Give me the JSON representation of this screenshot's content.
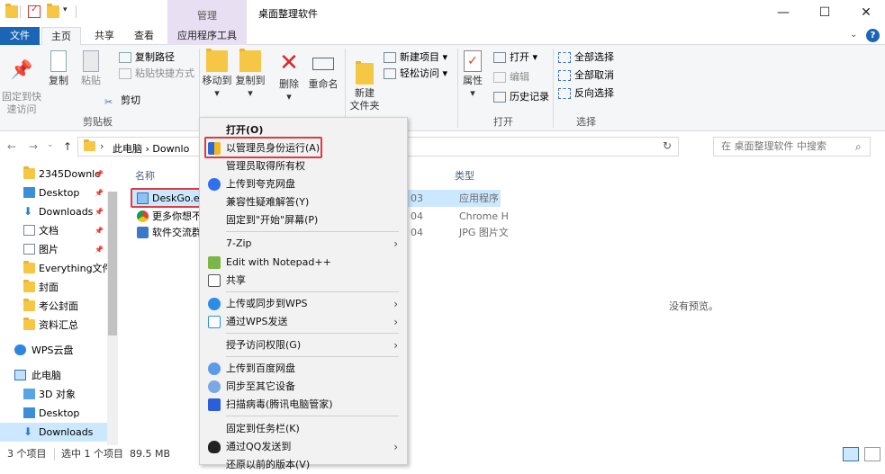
{
  "titlebar": {
    "manage": "管理",
    "title": "桌面整理软件",
    "minimize": "—",
    "maximize": "☐",
    "close": "✕"
  },
  "tabs": {
    "file": "文件",
    "home": "主页",
    "share": "共享",
    "view": "查看",
    "apptools": "应用程序工具"
  },
  "ribbon": {
    "pin": "固定到快\n速访问",
    "copy": "复制",
    "paste": "粘贴",
    "copy_path": "复制路径",
    "paste_shortcut": "粘贴快捷方式",
    "cut": "剪切",
    "clipboard": "剪贴板",
    "move_to": "移动到",
    "copy_to": "复制到",
    "delete": "删除",
    "rename": "重命名",
    "new_item": "新建项目",
    "easy_access": "轻松访问",
    "new_folder": "新建\n文件夹",
    "properties": "属性",
    "open": "打开",
    "edit": "编辑",
    "history": "历史记录",
    "open_group": "打开",
    "select_all": "全部选择",
    "select_none": "全部取消",
    "invert": "反向选择",
    "select_group": "选择"
  },
  "address": {
    "back": "←",
    "forward": "→",
    "up": "↑",
    "path": "此电脑  ›  Downlo",
    "search": "在 桌面整理软件 中搜索"
  },
  "nav": [
    {
      "label": "2345Downlo",
      "pinned": true
    },
    {
      "label": "Desktop",
      "pinned": true
    },
    {
      "label": "Downloads",
      "pinned": true
    },
    {
      "label": "文档",
      "pinned": true
    },
    {
      "label": "图片",
      "pinned": true
    },
    {
      "label": "Everything文件",
      "pinned": false
    },
    {
      "label": "封面",
      "pinned": false
    },
    {
      "label": "考公封面",
      "pinned": false
    },
    {
      "label": "资料汇总",
      "pinned": false
    },
    {
      "label": "WPS云盘",
      "pinned": false
    },
    {
      "label": "此电脑",
      "pinned": false
    },
    {
      "label": "3D 对象",
      "pinned": false
    },
    {
      "label": "Desktop",
      "pinned": false
    },
    {
      "label": "Downloads",
      "pinned": false
    }
  ],
  "files": {
    "col_name": "名称",
    "col_type": "类型",
    "rows": [
      {
        "name": "DeskGo.e",
        "date": "03",
        "type": "应用程序"
      },
      {
        "name": "更多你想不",
        "date": "04",
        "type": "Chrome H"
      },
      {
        "name": "软件交流群",
        "date": "04",
        "type": "JPG 图片文"
      }
    ]
  },
  "preview": "没有预览。",
  "status": {
    "count": "3 个项目",
    "selected": "选中 1 个项目  89.5 MB"
  },
  "menu": [
    {
      "label": "打开(O)",
      "bold": true
    },
    {
      "label": "以管理员身份运行(A)"
    },
    {
      "label": "管理员取得所有权"
    },
    {
      "label": "上传到夸克网盘"
    },
    {
      "label": "兼容性疑难解答(Y)"
    },
    {
      "label": "固定到\"开始\"屏幕(P)"
    },
    {
      "label": "7-Zip",
      "sub": true
    },
    {
      "label": "Edit with Notepad++"
    },
    {
      "label": "共享"
    },
    {
      "label": "上传或同步到WPS",
      "sub": true
    },
    {
      "label": "通过WPS发送",
      "sub": true
    },
    {
      "label": "授予访问权限(G)",
      "sub": true
    },
    {
      "label": "上传到百度网盘"
    },
    {
      "label": "同步至其它设备"
    },
    {
      "label": "扫描病毒(腾讯电脑管家)"
    },
    {
      "label": "固定到任务栏(K)"
    },
    {
      "label": "通过QQ发送到",
      "sub": true
    },
    {
      "label": "还原以前的版本(V)"
    }
  ],
  "colors": {
    "accent": "#1a65b5",
    "manage_bg": "#e8dff2",
    "highlight": "#e0393e",
    "selected_row": "#cce8ff"
  }
}
